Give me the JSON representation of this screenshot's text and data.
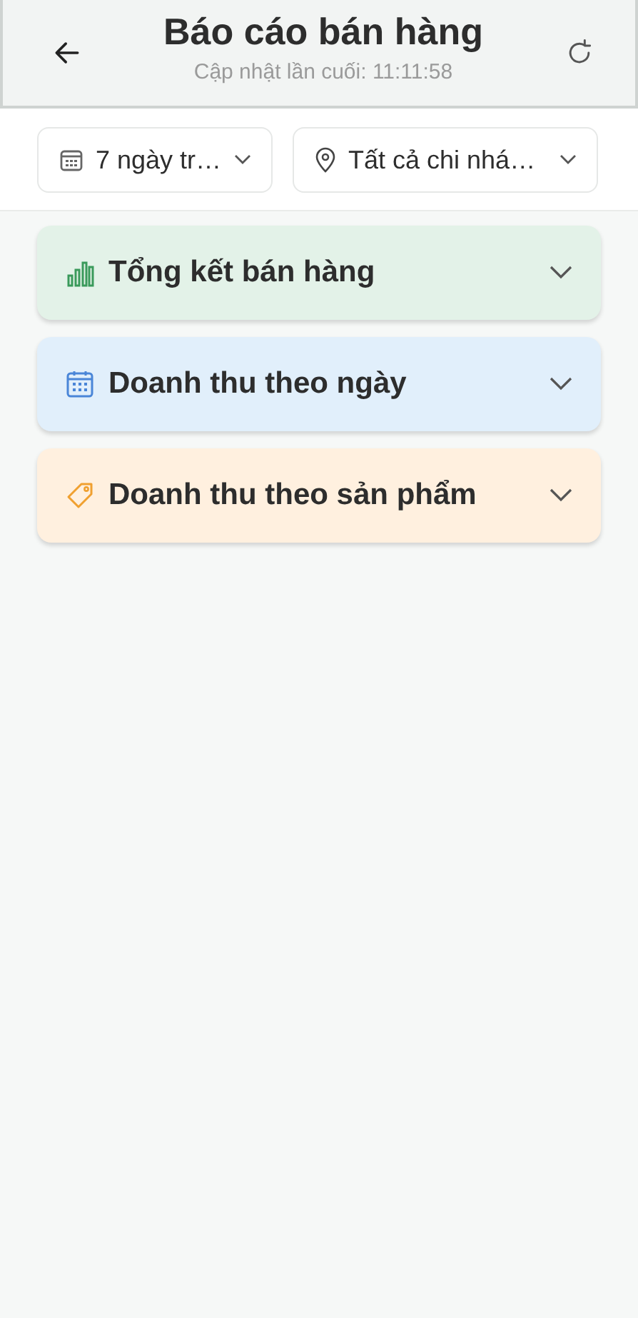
{
  "header": {
    "title": "Báo cáo bán hàng",
    "subtitle": "Cập nhật lần cuối: 11:11:58"
  },
  "filters": [
    {
      "kind": "date",
      "label": "7 ngày tr…"
    },
    {
      "kind": "location",
      "label": "Tất cả chi nhá…"
    }
  ],
  "sections": [
    {
      "kind": "chart",
      "title": "Tổng kết bán hàng",
      "color": "#3a9a5b",
      "expanded": false
    },
    {
      "kind": "calendar",
      "title": "Doanh thu theo ngày",
      "color": "#4a86d8",
      "expanded": false
    },
    {
      "kind": "tag",
      "title": "Doanh thu theo sản phẩm",
      "color": "#f0a030",
      "expanded": false
    }
  ]
}
